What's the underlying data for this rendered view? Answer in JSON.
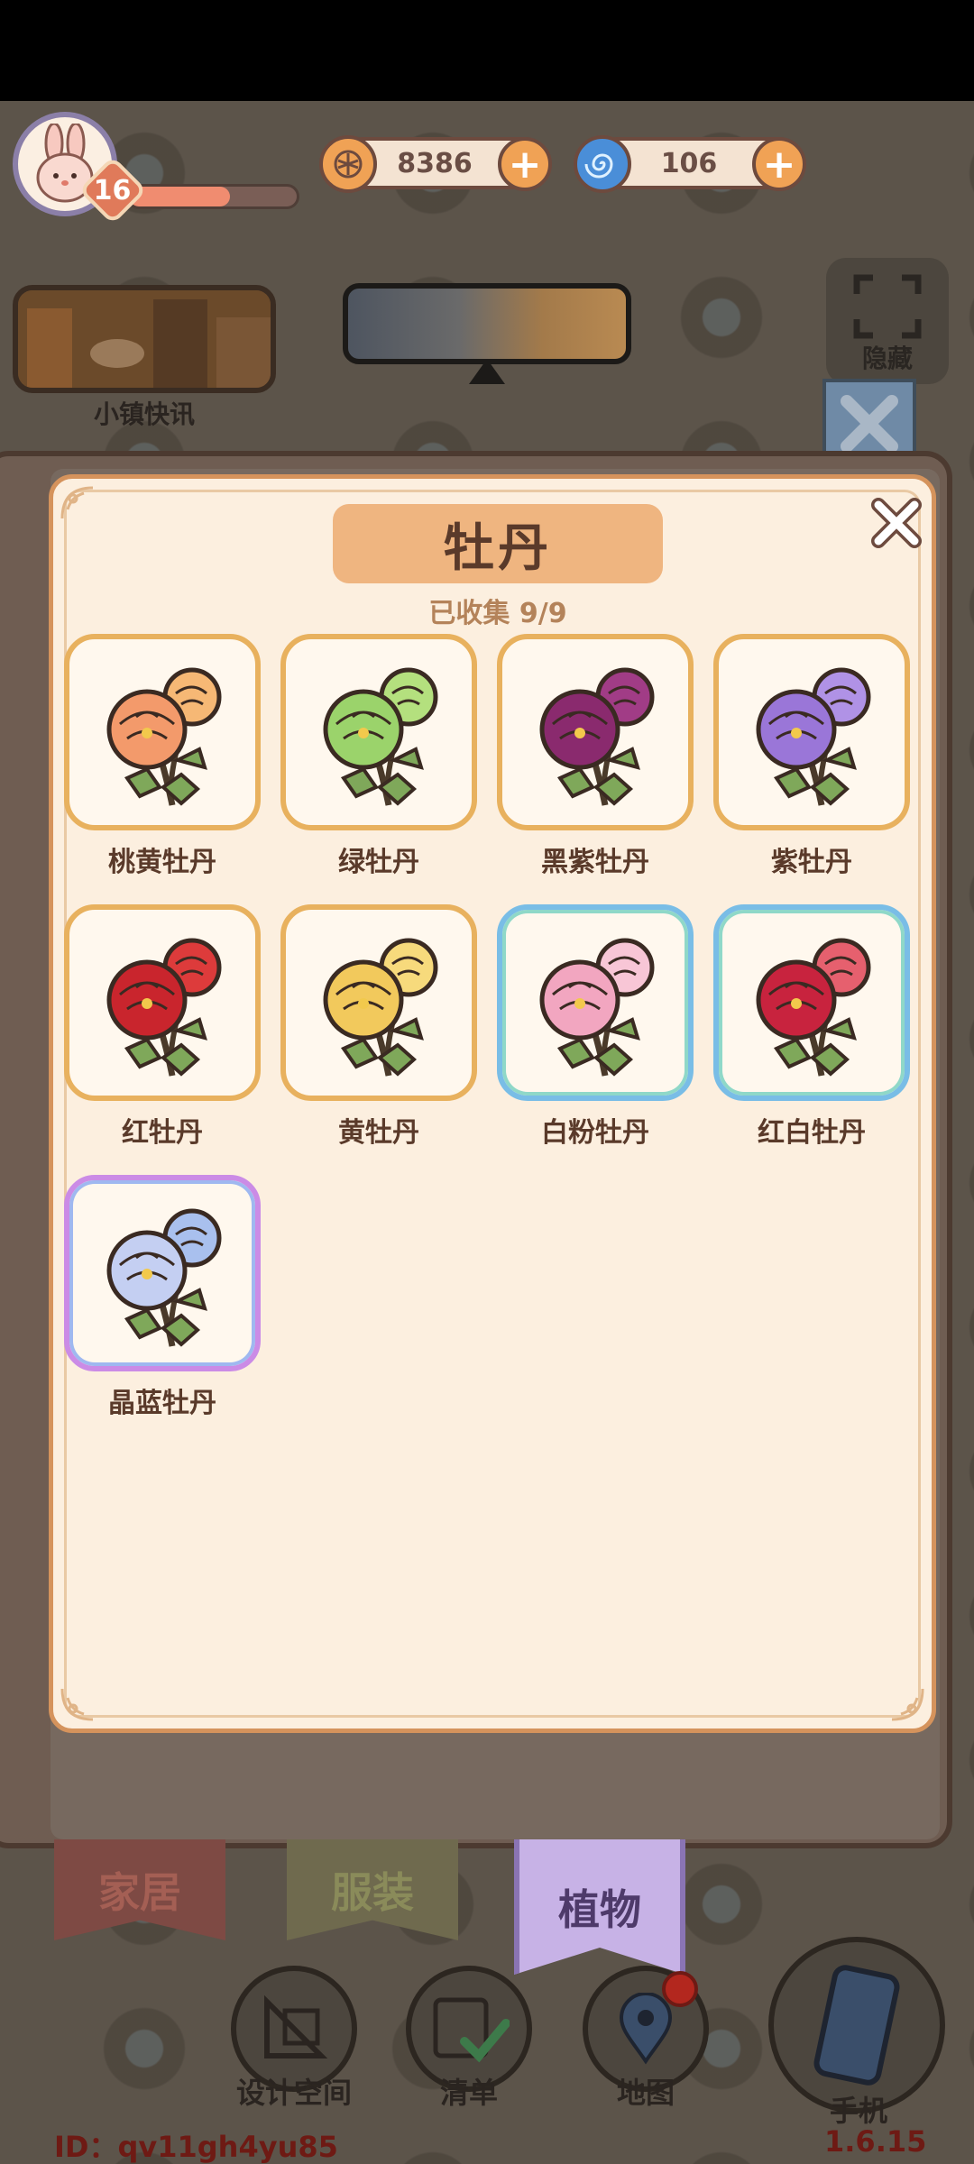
{
  "hud": {
    "level": "16",
    "xp_fraction": 0.6,
    "coins": {
      "value": "8386",
      "icon": "coin-icon",
      "color": "#f0a255"
    },
    "gems": {
      "value": "106",
      "icon": "spiral-gem-icon",
      "color": "#4a8ed8"
    }
  },
  "top": {
    "news_label": "小镇快讯",
    "hide_label": "隐藏"
  },
  "panel": {
    "title": "牡丹",
    "collected": "已收集  9/9",
    "items": [
      {
        "label": "桃黄牡丹",
        "frame": "gold",
        "petal": "#f39a6b",
        "petal2": "#f6b875"
      },
      {
        "label": "绿牡丹",
        "frame": "gold",
        "petal": "#9bd36b",
        "petal2": "#b4e07e"
      },
      {
        "label": "黑紫牡丹",
        "frame": "gold",
        "petal": "#8a2a6e",
        "petal2": "#a13c86"
      },
      {
        "label": "紫牡丹",
        "frame": "gold",
        "petal": "#9a76d8",
        "petal2": "#b092e6"
      },
      {
        "label": "红牡丹",
        "frame": "gold",
        "petal": "#c9252d",
        "petal2": "#dd3b3b"
      },
      {
        "label": "黄牡丹",
        "frame": "gold",
        "petal": "#f2c95c",
        "petal2": "#f7da7c"
      },
      {
        "label": "白粉牡丹",
        "frame": "blue",
        "petal": "#f2a6c0",
        "petal2": "#f8c6d6"
      },
      {
        "label": "红白牡丹",
        "frame": "blue",
        "petal": "#c8233e",
        "petal2": "#e6606e"
      },
      {
        "label": "晶蓝牡丹",
        "frame": "purple",
        "petal": "#c4cff2",
        "petal2": "#a9c0ee"
      }
    ]
  },
  "tabs": {
    "home": "家居",
    "clothes": "服装",
    "plants": "植物"
  },
  "nav": {
    "design": "设计空间",
    "list": "清单",
    "map": "地图",
    "phone": "手机"
  },
  "footer": {
    "id": "ID：qv11gh4yu85",
    "version": "1.6.15"
  }
}
